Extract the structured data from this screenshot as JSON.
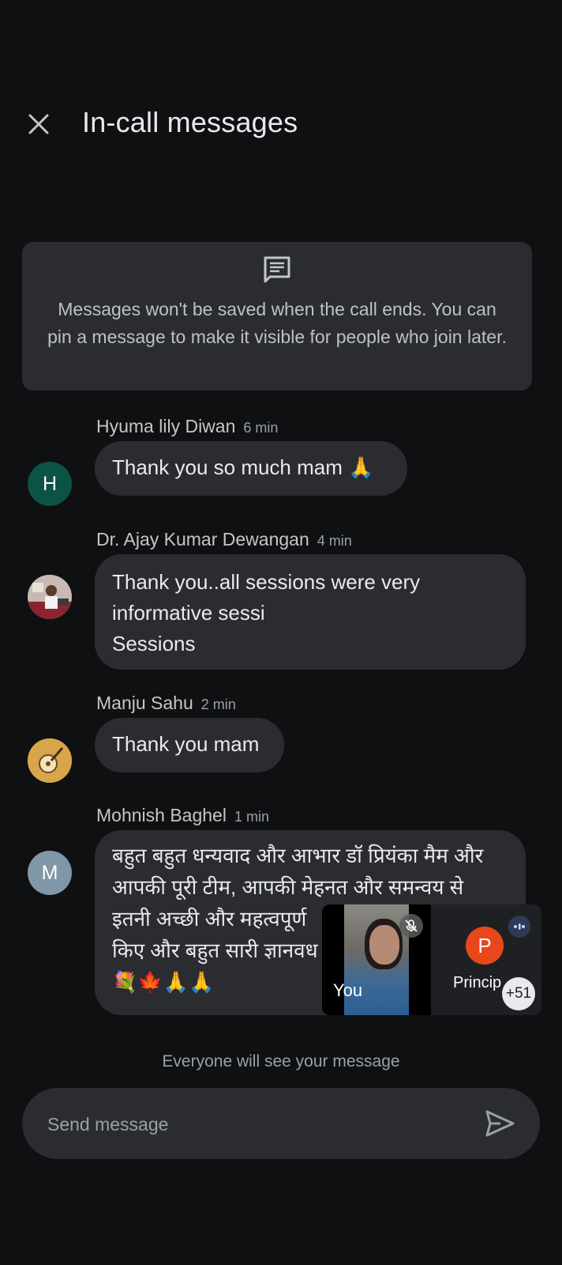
{
  "header": {
    "title": "In-call messages"
  },
  "info": {
    "text": "Messages won't be saved when the call ends. You can pin a message to make it visible for people who join later."
  },
  "messages": [
    {
      "sender": "Hyuma lily Diwan",
      "time": "6 min",
      "avatar_letter": "H",
      "avatar_color": "#0b5345",
      "text": "Thank you so much mam 🙏"
    },
    {
      "sender": "Dr. Ajay Kumar Dewangan",
      "time": "4 min",
      "text_lines": [
        "Thank you..all sessions were very",
        "informative sessi",
        "Sessions"
      ]
    },
    {
      "sender": "Manju Sahu",
      "time": "2 min",
      "text": "Thank you mam"
    },
    {
      "sender": "Mohnish Baghel",
      "time": "1 min",
      "avatar_letter": "M",
      "avatar_color": "#7f97a7",
      "text_lines": [
        "बहुत बहुत धन्यवाद और आभार डॉ प्रियंका मैम और",
        "आपकी पूरी टीम, आपकी मेहनत और समन्वय से",
        "इतनी अच्छी और महत्वपूर्ण",
        "किए और बहुत सारी ज्ञानवध",
        "💐🍁🙏🙏"
      ]
    }
  ],
  "pip": {
    "you_label": "You",
    "participant_letter": "P",
    "participant_label": "Princip",
    "participant_color": "#e8471c",
    "others_count": "+51"
  },
  "composer": {
    "notice": "Everyone will see your message",
    "placeholder": "Send message"
  }
}
